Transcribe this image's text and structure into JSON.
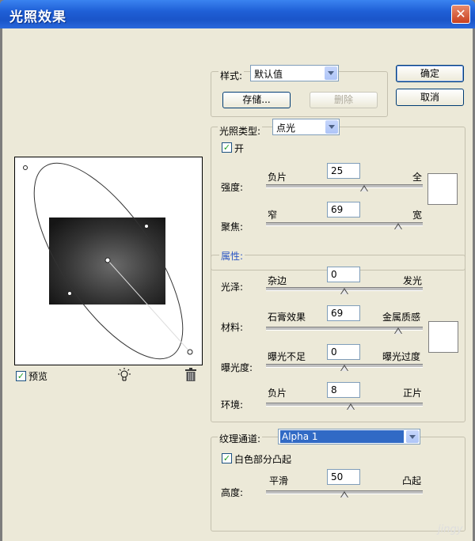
{
  "window": {
    "title": "光照效果",
    "close": "✕"
  },
  "style": {
    "label": "样式:",
    "value": "默认值",
    "save": "存储...",
    "delete": "删除"
  },
  "actions": {
    "ok": "确定",
    "cancel": "取消"
  },
  "light": {
    "type_label": "光照类型:",
    "type_value": "点光",
    "on_label": "开",
    "on_checked": true,
    "intensity": {
      "label": "强度:",
      "left": "负片",
      "right": "全",
      "value": "25",
      "level": 0.6
    },
    "focus": {
      "label": "聚焦:",
      "left": "窄",
      "right": "宽",
      "value": "69",
      "level": 0.85
    }
  },
  "properties": {
    "header": "属性:",
    "gloss": {
      "label": "光泽:",
      "left": "杂边",
      "right": "发光",
      "value": "0",
      "level": 0.5
    },
    "material": {
      "label": "材料:",
      "left": "石膏效果",
      "right": "金属质感",
      "value": "69",
      "level": 0.85
    },
    "exposure": {
      "label": "曝光度:",
      "left": "曝光不足",
      "right": "曝光过度",
      "value": "0",
      "level": 0.5
    },
    "ambience": {
      "label": "环境:",
      "left": "负片",
      "right": "正片",
      "value": "8",
      "level": 0.54
    }
  },
  "texture": {
    "channel_label": "纹理通道:",
    "channel_value": "Alpha 1",
    "white_high_label": "白色部分凸起",
    "white_high_checked": true,
    "height": {
      "label": "高度:",
      "left": "平滑",
      "right": "凸起",
      "value": "50",
      "level": 0.5
    }
  },
  "preview": {
    "label": "预览",
    "checked": true,
    "light_icon": "lightbulb-icon",
    "trash_icon": "trash-icon"
  },
  "colors": {
    "titlebar": "#1f5fd6",
    "dialog": "#ece9d8",
    "selection": "#316ac5"
  },
  "watermark": "jingy"
}
